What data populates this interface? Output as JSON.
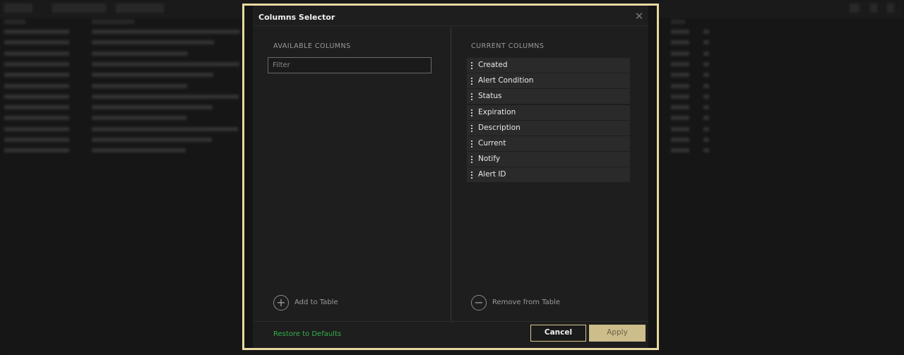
{
  "dialog": {
    "title": "Columns Selector",
    "close_glyph": "✕",
    "available": {
      "label": "AVAILABLE COLUMNS",
      "filter_placeholder": "Filter",
      "add_label": "Add to Table",
      "add_icon": "plus-circle-icon"
    },
    "current": {
      "label": "CURRENT COLUMNS",
      "items": [
        {
          "label": "Created"
        },
        {
          "label": "Alert Condition"
        },
        {
          "label": "Status"
        },
        {
          "label": "Expiration"
        },
        {
          "label": "Description"
        },
        {
          "label": "Current"
        },
        {
          "label": "Notify"
        },
        {
          "label": "Alert ID"
        }
      ],
      "remove_label": "Remove from Table",
      "remove_icon": "minus-circle-icon"
    },
    "footer": {
      "restore_label": "Restore to Defaults",
      "cancel_label": "Cancel",
      "apply_label": "Apply"
    }
  },
  "colors": {
    "accent_border": "#e8d9a2",
    "apply_bg": "#cdbd8a",
    "restore_link": "#33b04a"
  }
}
